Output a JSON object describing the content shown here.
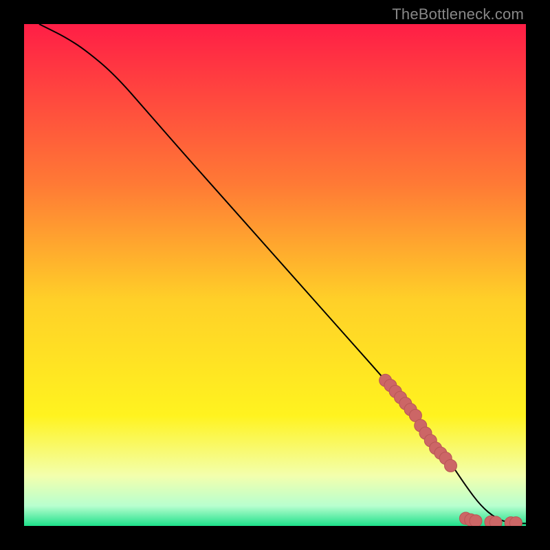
{
  "watermark": "TheBottleneck.com",
  "colors": {
    "gradient_top": "#ff1e46",
    "gradient_mid_orange": "#ff9a2f",
    "gradient_yellow": "#ffe81f",
    "gradient_pale": "#f6ffb8",
    "gradient_green": "#1ee08a",
    "curve": "#000000",
    "marker_fill": "#cc6666",
    "marker_stroke": "#b85555",
    "background": "#000000"
  },
  "chart_data": {
    "type": "line",
    "title": "",
    "xlabel": "",
    "ylabel": "",
    "xlim": [
      0,
      100
    ],
    "ylim": [
      0,
      100
    ],
    "grid": false,
    "legend": false,
    "series": [
      {
        "name": "curve",
        "kind": "line",
        "x": [
          3,
          5,
          8,
          12,
          18,
          25,
          32,
          40,
          48,
          56,
          64,
          72,
          78,
          84,
          88,
          91,
          94,
          97,
          100
        ],
        "y": [
          100,
          99,
          97.5,
          95,
          90,
          82,
          74,
          65,
          56,
          47,
          38,
          29,
          22,
          14,
          8,
          4,
          1.5,
          0.5,
          0.5
        ]
      },
      {
        "name": "markers-on-descent",
        "kind": "scatter",
        "x": [
          72,
          73,
          74,
          75,
          76,
          77,
          78,
          79,
          80,
          81,
          82,
          83,
          84,
          85
        ],
        "y": [
          29,
          28,
          26.8,
          25.6,
          24.4,
          23.2,
          22,
          20,
          18.5,
          17,
          15.5,
          14.5,
          13.5,
          12
        ]
      },
      {
        "name": "markers-at-bottom",
        "kind": "scatter",
        "x": [
          88,
          89,
          90,
          93,
          94,
          97,
          98
        ],
        "y": [
          1.5,
          1.2,
          1.0,
          0.8,
          0.7,
          0.6,
          0.6
        ]
      }
    ]
  }
}
